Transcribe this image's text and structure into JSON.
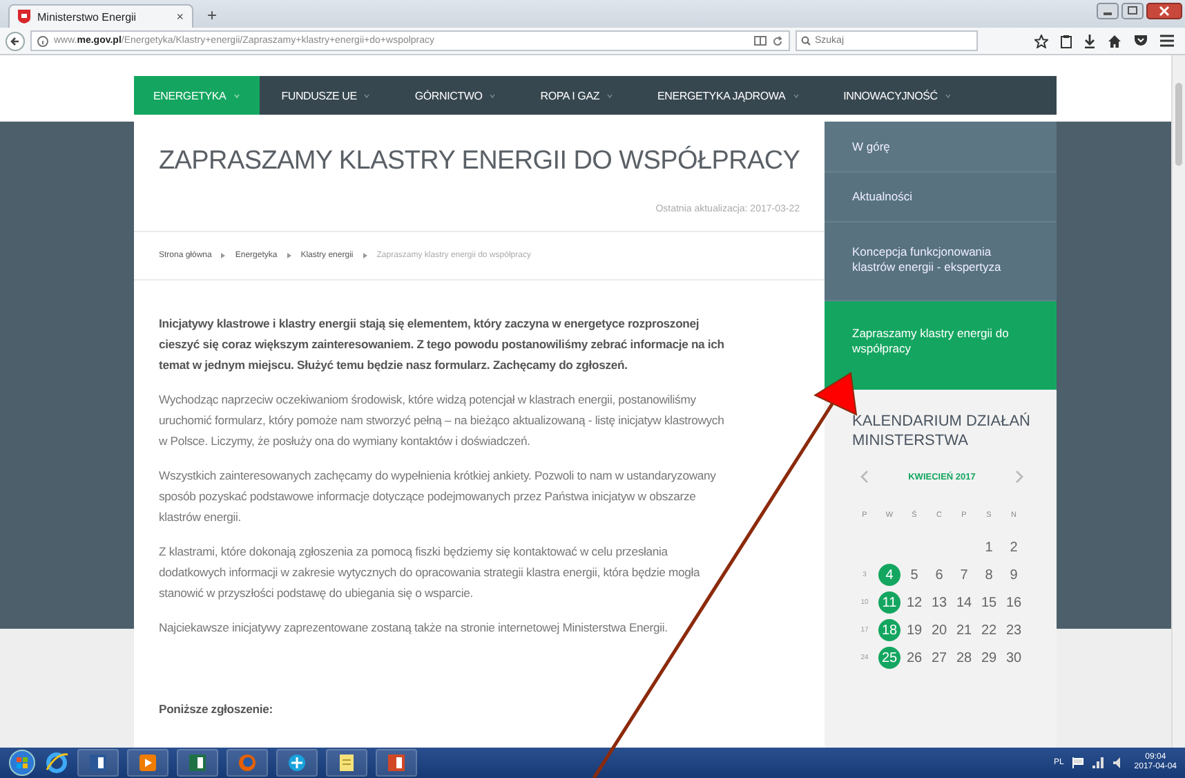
{
  "browser": {
    "tab": {
      "title": "Ministerstwo Energii",
      "close": "×",
      "selected": true
    },
    "new_tab": "+",
    "url": "www.**me.gov.pl**/Energetyka/Klastry+energii/Zapraszamy+klastry+energii+do+wspolpracy",
    "search": {
      "placeholder": "Szukaj"
    }
  },
  "nav": [
    {
      "label": "ENERGETYKA",
      "selected": true
    },
    {
      "label": "FUNDUSZE UE",
      "selected": false
    },
    {
      "label": "GÓRNICTWO",
      "selected": false
    },
    {
      "label": "ROPA I GAZ",
      "selected": false
    },
    {
      "label": "ENERGETYKA JĄDROWA",
      "selected": false
    },
    {
      "label": "INNOWACYJNOŚĆ",
      "selected": false
    }
  ],
  "article": {
    "title": "ZAPRASZAMY KLASTRY ENERGII DO WSPÓŁPRACY",
    "updated": "Ostatnia aktualizacja: 2017-03-22",
    "breadcrumb": [
      {
        "label": "Strona główna",
        "current": false
      },
      {
        "label": "Energetyka",
        "current": false
      },
      {
        "label": "Klastry energii",
        "current": false
      },
      {
        "label": "Zapraszamy klastry energii do współpracy",
        "current": true
      }
    ],
    "paragraphs": [
      {
        "kind": "lead",
        "text": "Inicjatywy klastrowe i klastry energii stają się elementem, który zaczyna w energetyce rozproszonej cieszyć się coraz większym zainteresowaniem. Z tego powodu postanowiliśmy zebrać informacje na ich temat w jednym miejscu. Służyć temu będzie nasz formularz. Zachęcamy do zgłoszeń."
      },
      {
        "kind": "body",
        "text": "Wychodząc naprzeciw oczekiwaniom środowisk, które widzą potencjał w klastrach energii, postanowiliśmy uruchomić formularz, który pomoże nam stworzyć pełną – na bieżąco aktualizowaną - listę inicjatyw klastrowych w Polsce. Liczymy, że posłuży ona do wymiany kontaktów i doświadczeń."
      },
      {
        "kind": "body",
        "text": "Wszystkich zainteresowanych zachęcamy do wypełnienia krótkiej ankiety. Pozwoli to nam w ustandaryzowany sposób pozyskać podstawowe informacje dotyczące podejmowanych przez Państwa inicjatyw w obszarze klastrów energii."
      },
      {
        "kind": "body",
        "text": "Z klastrami, które dokonają zgłoszenia za pomocą fiszki będziemy się kontaktować w celu przesłania dodatkowych informacji w zakresie wytycznych do opracowania strategii klastra energii, która będzie mogła stanowić w przyszłości podstawę do ubiegania się o wsparcie."
      },
      {
        "kind": "body",
        "text": "Najciekawsze inicjatywy zaprezentowane zostaną także na stronie internetowej Ministerstwa Energii."
      },
      {
        "kind": "subheading",
        "text": "Poniższe zgłoszenie:"
      }
    ]
  },
  "sidebar": {
    "items": [
      {
        "label": "W górę",
        "selected": false
      },
      {
        "label": "Aktualności",
        "selected": false
      },
      {
        "label": "Koncepcja funkcjonowania klastrów energii - ekspertyza",
        "selected": false
      },
      {
        "label": "Zapraszamy klastry energii do współpracy",
        "selected": true
      }
    ],
    "calendar": {
      "title": "KALENDARIUM DZIAŁAŃ MINISTERSTWA",
      "month": "KWIECIEŃ 2017",
      "weekdays": [
        "P",
        "W",
        "Ś",
        "C",
        "P",
        "S",
        "N"
      ],
      "weeks": [
        [
          {
            "day": "1",
            "event": false,
            "dimmed": false
          },
          {
            "day": "2",
            "event": false,
            "dimmed": false
          }
        ],
        [
          {
            "day": "3",
            "event": false,
            "dimmed": true
          },
          {
            "day": "4",
            "event": true,
            "dimmed": false
          },
          {
            "day": "5",
            "event": false,
            "dimmed": false
          },
          {
            "day": "6",
            "event": false,
            "dimmed": false
          },
          {
            "day": "7",
            "event": false,
            "dimmed": false
          },
          {
            "day": "8",
            "event": false,
            "dimmed": false
          },
          {
            "day": "9",
            "event": false,
            "dimmed": false
          }
        ],
        [
          {
            "day": "10",
            "event": false,
            "dimmed": true
          },
          {
            "day": "11",
            "event": true,
            "dimmed": false
          },
          {
            "day": "12",
            "event": false,
            "dimmed": false
          },
          {
            "day": "13",
            "event": false,
            "dimmed": false
          },
          {
            "day": "14",
            "event": false,
            "dimmed": false
          },
          {
            "day": "15",
            "event": false,
            "dimmed": false
          },
          {
            "day": "16",
            "event": false,
            "dimmed": false
          }
        ],
        [
          {
            "day": "17",
            "event": false,
            "dimmed": true
          },
          {
            "day": "18",
            "event": true,
            "dimmed": false
          },
          {
            "day": "19",
            "event": false,
            "dimmed": false
          },
          {
            "day": "20",
            "event": false,
            "dimmed": false
          },
          {
            "day": "21",
            "event": false,
            "dimmed": false
          },
          {
            "day": "22",
            "event": false,
            "dimmed": false
          },
          {
            "day": "23",
            "event": false,
            "dimmed": false
          }
        ],
        [
          {
            "day": "24",
            "event": false,
            "dimmed": true
          },
          {
            "day": "25",
            "event": true,
            "dimmed": false
          },
          {
            "day": "26",
            "event": false,
            "dimmed": false
          },
          {
            "day": "27",
            "event": false,
            "dimmed": false
          },
          {
            "day": "28",
            "event": false,
            "dimmed": false
          },
          {
            "day": "29",
            "event": false,
            "dimmed": false
          },
          {
            "day": "30",
            "event": false,
            "dimmed": false
          }
        ]
      ]
    }
  },
  "taskbar": {
    "language": "PL",
    "time": "09:04",
    "date": "2017-04-04"
  }
}
